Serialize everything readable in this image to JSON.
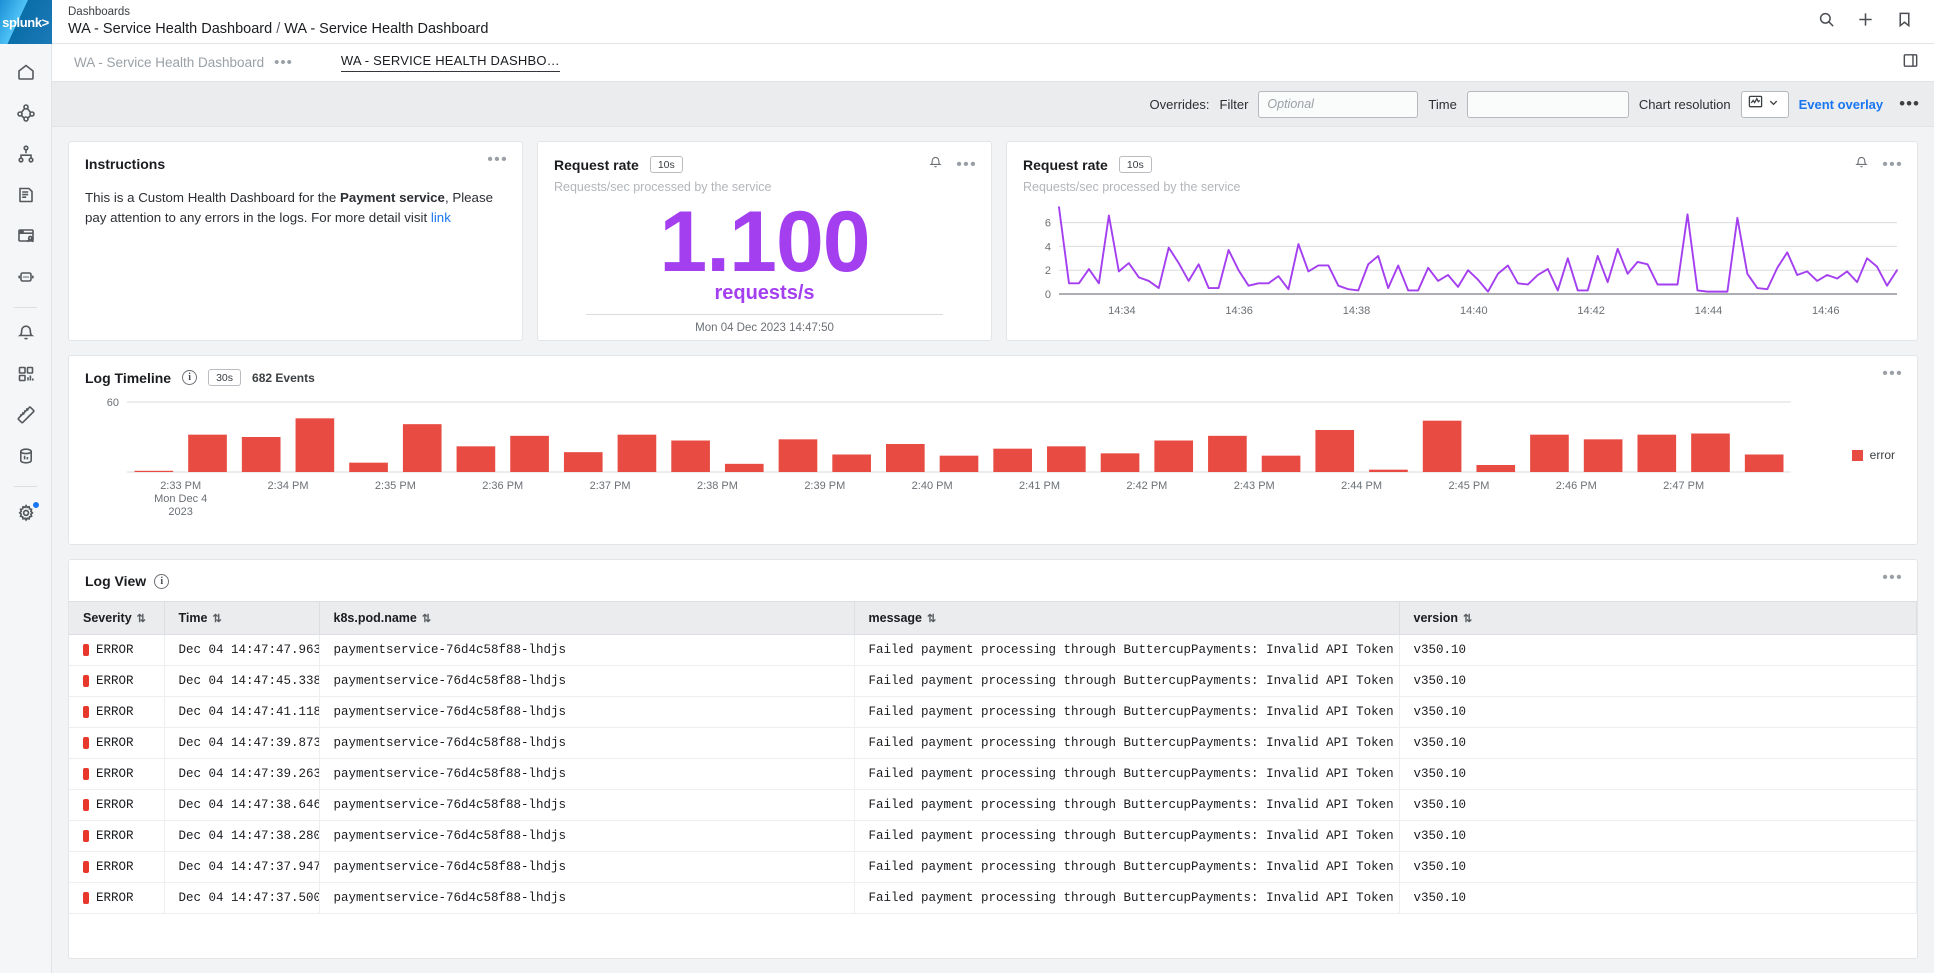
{
  "brand": {
    "logo_text": "splunk>"
  },
  "rail": {
    "items": [
      {
        "name": "home-icon",
        "label": "Home"
      },
      {
        "name": "service-map-icon",
        "label": "Service map"
      },
      {
        "name": "topology-icon",
        "label": "Topology"
      },
      {
        "name": "logs-icon",
        "label": "Logs"
      },
      {
        "name": "rum-icon",
        "label": "RUM"
      },
      {
        "name": "synthetics-robot-icon",
        "label": "Synthetics"
      },
      {
        "name": "alerts-bell-icon",
        "label": "Alerts"
      },
      {
        "name": "dashboards-icon",
        "label": "Dashboards"
      },
      {
        "name": "metrics-ruler-icon",
        "label": "Metrics"
      },
      {
        "name": "data-store-icon",
        "label": "Data"
      },
      {
        "name": "settings-gear-icon",
        "label": "Settings"
      }
    ]
  },
  "header": {
    "breadcrumb_top": "Dashboards",
    "breadcrumb_group": "WA - Service Health Dashboard",
    "breadcrumb_sep": "/",
    "breadcrumb_page": "WA - Service Health Dashboard",
    "icons": [
      {
        "name": "search-icon"
      },
      {
        "name": "plus-icon"
      },
      {
        "name": "bookmark-icon"
      }
    ]
  },
  "tabs": {
    "group_label": "WA - Service Health Dashboard",
    "group_dots": "•••",
    "active_label": "WA - SERVICE HEALTH DASHBO…",
    "panel_toggle": "sidebar-panel-toggle-icon"
  },
  "toolbar": {
    "overrides_label": "Overrides:",
    "filter_label": "Filter",
    "filter_value": "",
    "filter_placeholder": "Optional",
    "time_label": "Time",
    "time_value": "",
    "time_placeholder": "",
    "chart_resolution_label": "Chart resolution",
    "chart_resolution_value": "auto",
    "event_overlay_label": "Event overlay",
    "more_dots": "•••"
  },
  "instructions": {
    "title": "Instructions",
    "text_part1": "This is a Custom Health Dashboard for the ",
    "bold_text": "Payment service",
    "text_part2": ", Please pay attention to any errors in the logs. For more detail visit ",
    "link_text": "link",
    "dots": "•••"
  },
  "request_rate_single": {
    "title": "Request rate",
    "pill": "10s",
    "subtitle": "Requests/sec processed by the service",
    "value": "1.100",
    "unit": "requests/s",
    "timestamp": "Mon 04 Dec 2023 14:47:50",
    "alert_icon": "bell-icon",
    "dots": "•••",
    "color": "#a43ff0"
  },
  "request_rate_chart": {
    "title": "Request rate",
    "pill": "10s",
    "subtitle": "Requests/sec processed by the service",
    "alert_icon": "bell-icon",
    "dots": "•••"
  },
  "log_timeline": {
    "title": "Log Timeline",
    "info_icon": "info-icon",
    "pill": "30s",
    "event_count": "682 Events",
    "dots": "•••",
    "legend": [
      {
        "label": "error",
        "color": "#e84b41"
      }
    ]
  },
  "log_view": {
    "title": "Log View",
    "info_icon": "info-icon",
    "dots": "•••",
    "columns": [
      {
        "key": "severity",
        "label": "Severity"
      },
      {
        "key": "time",
        "label": "Time"
      },
      {
        "key": "pod",
        "label": "k8s.pod.name"
      },
      {
        "key": "message",
        "label": "message"
      },
      {
        "key": "version",
        "label": "version"
      }
    ],
    "sort_glyph": "⇅",
    "rows": [
      {
        "severity": "ERROR",
        "time": "Dec 04 14:47:47.963",
        "pod": "paymentservice-76d4c58f88-lhdjs",
        "message": "Failed payment processing through ButtercupPayments: Invalid API Token (te",
        "version": "v350.10"
      },
      {
        "severity": "ERROR",
        "time": "Dec 04 14:47:45.338",
        "pod": "paymentservice-76d4c58f88-lhdjs",
        "message": "Failed payment processing through ButtercupPayments: Invalid API Token (te",
        "version": "v350.10"
      },
      {
        "severity": "ERROR",
        "time": "Dec 04 14:47:41.118",
        "pod": "paymentservice-76d4c58f88-lhdjs",
        "message": "Failed payment processing through ButtercupPayments: Invalid API Token (te",
        "version": "v350.10"
      },
      {
        "severity": "ERROR",
        "time": "Dec 04 14:47:39.873",
        "pod": "paymentservice-76d4c58f88-lhdjs",
        "message": "Failed payment processing through ButtercupPayments: Invalid API Token (te",
        "version": "v350.10"
      },
      {
        "severity": "ERROR",
        "time": "Dec 04 14:47:39.263",
        "pod": "paymentservice-76d4c58f88-lhdjs",
        "message": "Failed payment processing through ButtercupPayments: Invalid API Token (te",
        "version": "v350.10"
      },
      {
        "severity": "ERROR",
        "time": "Dec 04 14:47:38.646",
        "pod": "paymentservice-76d4c58f88-lhdjs",
        "message": "Failed payment processing through ButtercupPayments: Invalid API Token (te",
        "version": "v350.10"
      },
      {
        "severity": "ERROR",
        "time": "Dec 04 14:47:38.280",
        "pod": "paymentservice-76d4c58f88-lhdjs",
        "message": "Failed payment processing through ButtercupPayments: Invalid API Token (te",
        "version": "v350.10"
      },
      {
        "severity": "ERROR",
        "time": "Dec 04 14:47:37.947",
        "pod": "paymentservice-76d4c58f88-lhdjs",
        "message": "Failed payment processing through ButtercupPayments: Invalid API Token (te",
        "version": "v350.10"
      },
      {
        "severity": "ERROR",
        "time": "Dec 04 14:47:37.500",
        "pod": "paymentservice-76d4c58f88-lhdjs",
        "message": "Failed payment processing through ButtercupPayments: Invalid API Token (te",
        "version": "v350.10"
      }
    ]
  },
  "chart_data": [
    {
      "id": "request_rate_line",
      "type": "line",
      "title": "Request rate",
      "subtitle": "Requests/sec processed by the service",
      "xlabel": "",
      "ylabel": "",
      "ylim": [
        0,
        7.4
      ],
      "yticks": [
        0,
        2,
        4,
        6
      ],
      "grid": true,
      "legend": "none",
      "color": "#a43ff0",
      "xticks": [
        "14:34",
        "14:36",
        "14:38",
        "14:40",
        "14:42",
        "14:44",
        "14:46"
      ],
      "xtick_positions": [
        0.075,
        0.215,
        0.355,
        0.495,
        0.635,
        0.775,
        0.915
      ],
      "series": [
        {
          "name": "requests/s",
          "values": [
            7.3,
            0.9,
            0.9,
            2.1,
            0.9,
            6.6,
            1.9,
            2.6,
            1.4,
            1.1,
            0.5,
            3.9,
            2.6,
            1.1,
            2.5,
            0.5,
            0.5,
            3.7,
            2.0,
            0.7,
            0.9,
            0.9,
            1.5,
            0.4,
            4.2,
            1.9,
            2.4,
            2.4,
            0.7,
            0.4,
            0.3,
            2.5,
            3.2,
            0.5,
            2.4,
            0.3,
            0.3,
            2.2,
            1.1,
            1.6,
            0.6,
            2.0,
            1.2,
            0.2,
            1.7,
            2.4,
            0.9,
            0.8,
            1.6,
            2.1,
            0.3,
            3.0,
            0.3,
            0.3,
            3.2,
            1.0,
            3.8,
            1.7,
            2.7,
            2.5,
            0.8,
            0.8,
            0.8,
            6.7,
            0.3,
            0.2,
            0.2,
            0.2,
            6.4,
            1.7,
            0.5,
            0.4,
            2.2,
            3.5,
            1.6,
            1.9,
            1.1,
            1.6,
            1.3,
            1.9,
            1.0,
            3.0,
            2.3,
            0.7,
            2.0
          ]
        }
      ]
    },
    {
      "id": "log_timeline_bars",
      "type": "bar",
      "title": "Log Timeline",
      "xlabel": "",
      "ylabel": "",
      "ylim": [
        0,
        60
      ],
      "yticks": [
        60
      ],
      "grid": true,
      "legend": "right",
      "color": "#e84b41",
      "x_first_label": "2:33 PM",
      "x_first_sublabel_1": "Mon Dec 4",
      "x_first_sublabel_2": "2023",
      "xticks": [
        "2:33 PM",
        "2:34 PM",
        "2:35 PM",
        "2:36 PM",
        "2:37 PM",
        "2:38 PM",
        "2:39 PM",
        "2:40 PM",
        "2:41 PM",
        "2:42 PM",
        "2:43 PM",
        "2:44 PM",
        "2:45 PM",
        "2:46 PM",
        "2:47 PM"
      ],
      "series": [
        {
          "name": "error",
          "values": [
            1,
            32,
            30,
            46,
            8,
            41,
            22,
            31,
            17,
            32,
            27,
            7,
            28,
            15,
            24,
            14,
            20,
            22,
            16,
            27,
            31,
            14,
            36,
            2,
            44,
            6,
            32,
            28,
            32,
            33,
            15
          ]
        }
      ]
    }
  ]
}
